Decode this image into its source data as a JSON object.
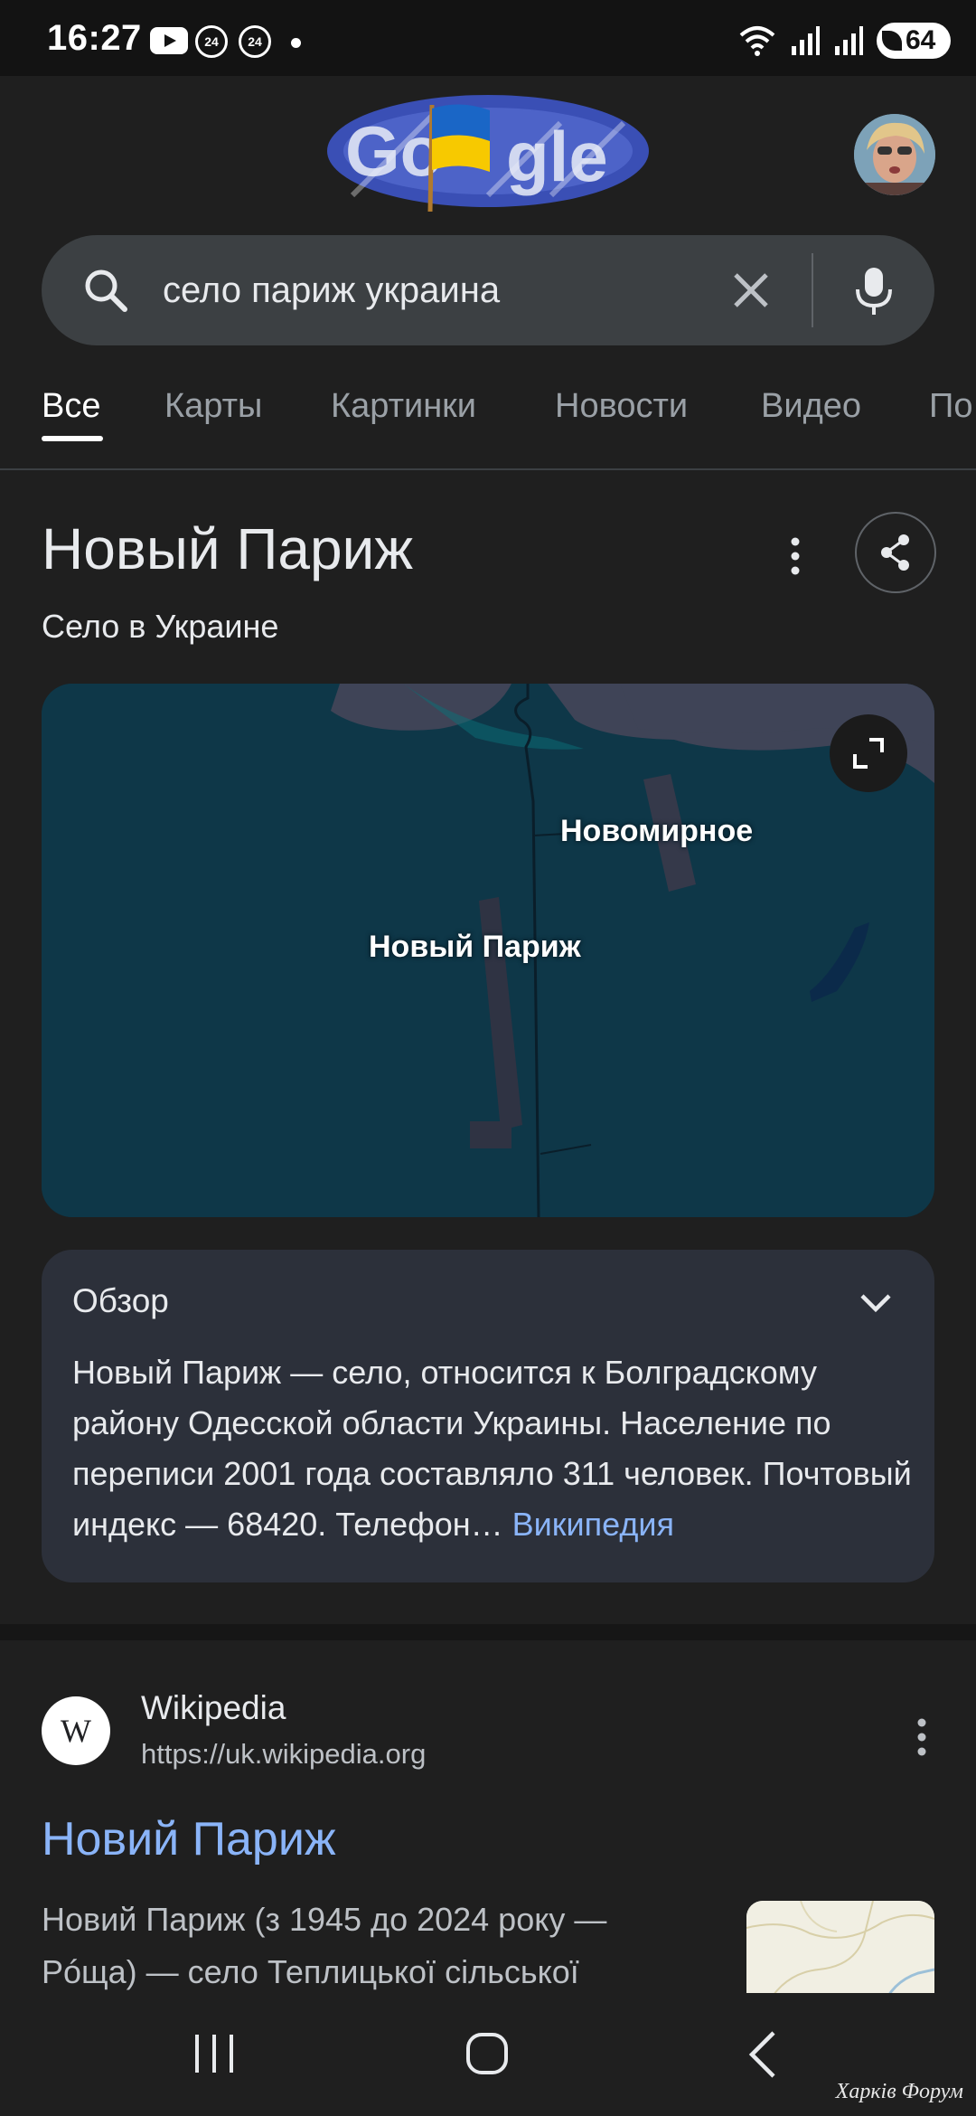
{
  "status_bar": {
    "time": "16:27",
    "badge_1": "24",
    "badge_2": "24",
    "battery": "64",
    "icons": [
      "youtube-icon",
      "notification-badge-icon",
      "notification-badge-icon",
      "dot-icon",
      "wifi-icon",
      "signal-icon",
      "signal-icon",
      "battery-icon"
    ]
  },
  "header": {
    "doodle_text": "Google",
    "colors": {
      "doodle_blue": "#3a4fb5",
      "flag_blue": "#1a66c6",
      "flag_yellow": "#f7c900"
    }
  },
  "search": {
    "query": "село париж украина",
    "icons": [
      "search-icon",
      "clear-icon",
      "mic-icon"
    ]
  },
  "tabs": [
    {
      "label": "Все",
      "active": true
    },
    {
      "label": "Карты",
      "active": false
    },
    {
      "label": "Картинки",
      "active": false
    },
    {
      "label": "Новости",
      "active": false
    },
    {
      "label": "Видео",
      "active": false
    },
    {
      "label": "По",
      "active": false
    }
  ],
  "knowledge_panel": {
    "title": "Новый Париж",
    "subtitle": "Село в Украине",
    "map": {
      "labels": [
        "Новомирное",
        "Новый Париж"
      ]
    },
    "overview": {
      "title": "Обзор",
      "text": "Новый Париж — село, относится к Болградскому району Одесской области Украины. Население по переписи 2001 года составляло 311 человек. Почтовый индекс — 68420. Телефон… ",
      "link": "Википедия"
    }
  },
  "result": {
    "favicon": "W",
    "site_name": "Wikipedia",
    "url": "https://uk.wikipedia.org",
    "title": "Новий Париж",
    "snippet": "Новий Париж (з 1945 до 2024 року —\nРóща) — село Теплицької сільської"
  },
  "nav_bar": {
    "icons": [
      "recent-apps-icon",
      "home-icon",
      "back-icon"
    ]
  },
  "watermark": "Харків Форум",
  "colors": {
    "background": "#1f1f1f",
    "link": "#8ab4f8",
    "search_box": "#3c4043",
    "overview_card": "#2c303a",
    "map_water": "#0e3748"
  }
}
